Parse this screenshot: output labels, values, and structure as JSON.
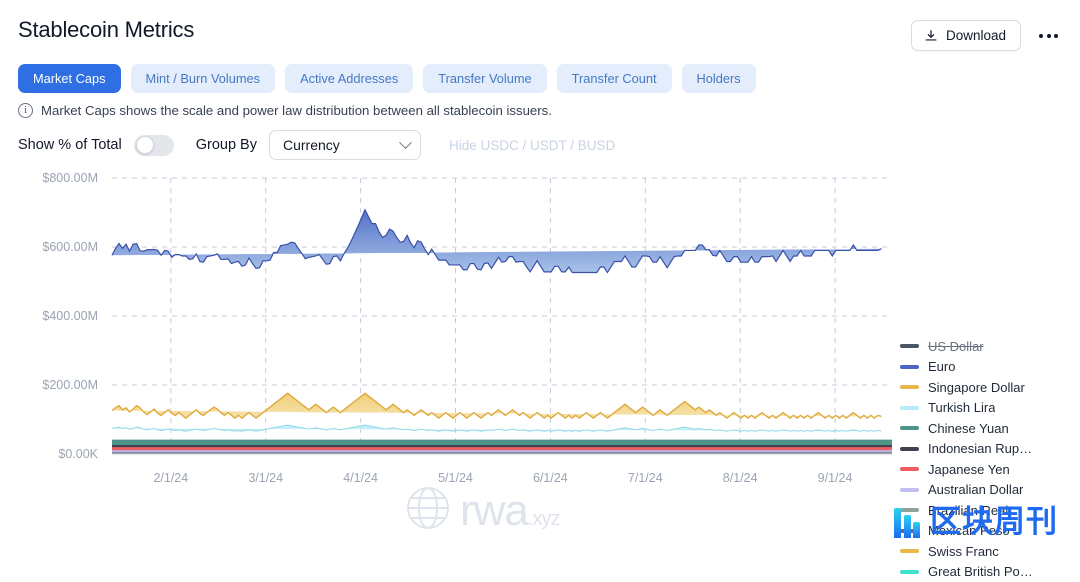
{
  "header": {
    "title": "Stablecoin Metrics",
    "download_label": "Download",
    "download_icon": "download-icon",
    "more_icon": "ellipsis-icon"
  },
  "tabs": [
    {
      "label": "Market Caps",
      "active": true
    },
    {
      "label": "Mint / Burn Volumes",
      "active": false
    },
    {
      "label": "Active Addresses",
      "active": false
    },
    {
      "label": "Transfer Volume",
      "active": false
    },
    {
      "label": "Transfer Count",
      "active": false
    },
    {
      "label": "Holders",
      "active": false
    }
  ],
  "info": {
    "icon": "info-circle-icon",
    "text": "Market Caps shows the scale and power law distribution between all stablecoin issuers."
  },
  "controls": {
    "percent_label": "Show % of Total",
    "percent_toggle_on": false,
    "group_by_label": "Group By",
    "group_by_value": "Currency",
    "group_by_options": [
      "Currency"
    ],
    "hide_stables_label": "Hide USDC / USDT / BUSD",
    "hide_stables_disabled": true
  },
  "watermark": {
    "text": "rwa",
    "suffix": ".xyz",
    "icon": "globe-icon"
  },
  "brand": {
    "text": "区块周刊",
    "icon": "bars-logo-icon"
  },
  "chart_data": {
    "type": "area",
    "stacked": true,
    "title": "",
    "xlabel": "",
    "ylabel": "",
    "grid": true,
    "legend_position": "right",
    "ylim": [
      0,
      800000000
    ],
    "ytick_labels": [
      "$800.00M",
      "$600.00M",
      "$400.00M",
      "$200.00M",
      "$0.00K"
    ],
    "ytick_values": [
      800000000,
      600000000,
      400000000,
      200000000,
      0
    ],
    "xtick_labels": [
      "2/1/24",
      "3/1/24",
      "4/1/24",
      "5/1/24",
      "6/1/24",
      "7/1/24",
      "8/1/24",
      "9/1/24"
    ],
    "colors": {
      "US Dollar": "#4b5563",
      "Euro": "#4e63c8",
      "Singapore Dollar": "#e8b84b",
      "Turkish Lira": "#b6ecf5",
      "Chinese Yuan": "#4e9488",
      "Indonesian Rupiah": "#3f4450",
      "Japanese Yen": "#ef5d62",
      "Australian Dollar": "#c0bdf0",
      "Brazilian Real": "#8fa39a",
      "Mexican Peso": "#5a5fb8",
      "Swiss Franc": "#e8b84b",
      "Great British Pound": "#3fe0cc"
    },
    "legend": [
      {
        "label": "US Dollar",
        "color": "#4b5563",
        "hidden": true
      },
      {
        "label": "Euro",
        "color": "#4e63c8",
        "hidden": false
      },
      {
        "label": "Singapore Dollar",
        "color": "#e8b84b",
        "hidden": false
      },
      {
        "label": "Turkish Lira",
        "color": "#b6ecf5",
        "hidden": false
      },
      {
        "label": "Chinese Yuan",
        "color": "#4e9488",
        "hidden": false
      },
      {
        "label": "Indonesian Rup…",
        "color": "#3f4450",
        "hidden": false
      },
      {
        "label": "Japanese Yen",
        "color": "#ef5d62",
        "hidden": false
      },
      {
        "label": "Australian Dollar",
        "color": "#c0bdf0",
        "hidden": false
      },
      {
        "label": "Brazilian Real",
        "color": "#8fa39a",
        "hidden": false
      },
      {
        "label": "Mexican Peso",
        "color": "#5a5fb8",
        "hidden": false
      },
      {
        "label": "Swiss Franc",
        "color": "#e8b84b",
        "hidden": false
      },
      {
        "label": "Great British Po…",
        "color": "#3fe0cc",
        "hidden": false
      }
    ],
    "series": [
      {
        "name": "Euro",
        "values": [
          450,
          462,
          470,
          468,
          474,
          466,
          478,
          470,
          455,
          466,
          478,
          470,
          463,
          472,
          464,
          470,
          460,
          452,
          466,
          458,
          462,
          470,
          452,
          446,
          452,
          440,
          444,
          452,
          446,
          440,
          450,
          444,
          452,
          446,
          440,
          452,
          446,
          440,
          436,
          448,
          440,
          434,
          428,
          440,
          432,
          426,
          440,
          432,
          444,
          438,
          432,
          446,
          452,
          444,
          438,
          430,
          442,
          436,
          430,
          442,
          436,
          430,
          424,
          436,
          446,
          440,
          452,
          460,
          472,
          486,
          500,
          516,
          532,
          520,
          508,
          516,
          500,
          492,
          506,
          516,
          502,
          492,
          486,
          496,
          506,
          492,
          486,
          498,
          486,
          474,
          466,
          474,
          466,
          458,
          450,
          442,
          436,
          444,
          436,
          428,
          422,
          430,
          440,
          432,
          424,
          430,
          440,
          434,
          426,
          434,
          442,
          436,
          446,
          452,
          444,
          436,
          446,
          438,
          430,
          424,
          432,
          440,
          432,
          424,
          416,
          424,
          432,
          424,
          416,
          424,
          430,
          422,
          414,
          422,
          414,
          406,
          414,
          422,
          414,
          422,
          430,
          422,
          430,
          438,
          430,
          422,
          430,
          422,
          414,
          422,
          430,
          438,
          446,
          452,
          444,
          436,
          444,
          436,
          428,
          436,
          444,
          438,
          430,
          438,
          446,
          454,
          462,
          470,
          478,
          472,
          464,
          456,
          462,
          470,
          462,
          454,
          446,
          452,
          460,
          452,
          444,
          452,
          460,
          452,
          444,
          452,
          460,
          468,
          462,
          454,
          462,
          470,
          462,
          454,
          462,
          470,
          478,
          470,
          462,
          470,
          478,
          470,
          478,
          486,
          478,
          470,
          478,
          486,
          478,
          486,
          478,
          486,
          478,
          486,
          478,
          486,
          478,
          486,
          478,
          486,
          478,
          486,
          490
        ]
      },
      {
        "name": "Singapore Dollar",
        "values": [
          52,
          58,
          62,
          54,
          58,
          50,
          56,
          62,
          58,
          50,
          44,
          50,
          56,
          48,
          44,
          50,
          56,
          48,
          44,
          50,
          44,
          38,
          44,
          50,
          56,
          48,
          44,
          50,
          56,
          62,
          58,
          50,
          44,
          50,
          44,
          38,
          44,
          38,
          44,
          50,
          44,
          38,
          44,
          50,
          56,
          62,
          68,
          74,
          80,
          86,
          92,
          86,
          80,
          74,
          68,
          62,
          56,
          62,
          68,
          62,
          56,
          50,
          56,
          62,
          56,
          50,
          56,
          62,
          68,
          74,
          80,
          86,
          92,
          86,
          80,
          74,
          68,
          62,
          56,
          62,
          68,
          62,
          56,
          50,
          56,
          50,
          44,
          50,
          56,
          50,
          44,
          50,
          44,
          38,
          44,
          50,
          44,
          38,
          44,
          50,
          44,
          38,
          44,
          50,
          44,
          38,
          44,
          50,
          44,
          50,
          56,
          50,
          44,
          50,
          56,
          50,
          44,
          50,
          44,
          38,
          44,
          50,
          44,
          38,
          44,
          38,
          44,
          50,
          44,
          38,
          44,
          38,
          44,
          38,
          44,
          50,
          44,
          38,
          44,
          50,
          44,
          38,
          44,
          50,
          56,
          62,
          68,
          62,
          56,
          50,
          56,
          62,
          56,
          50,
          44,
          50,
          56,
          50,
          44,
          50,
          56,
          62,
          68,
          74,
          68,
          62,
          56,
          62,
          56,
          50,
          56,
          50,
          44,
          50,
          44,
          38,
          44,
          50,
          44,
          38,
          44,
          38,
          44,
          38,
          44,
          50,
          44,
          38,
          44,
          38,
          44,
          50,
          44,
          38,
          44,
          38,
          44,
          38,
          44,
          38,
          44,
          50,
          44,
          38,
          44,
          38,
          44,
          38,
          44,
          38,
          44,
          50,
          44,
          38,
          44,
          38,
          44,
          38,
          44,
          42
        ]
      },
      {
        "name": "Turkish Lira",
        "values": [
          34,
          36,
          38,
          34,
          36,
          32,
          34,
          38,
          36,
          32,
          30,
          32,
          34,
          30,
          28,
          30,
          32,
          30,
          28,
          30,
          28,
          26,
          28,
          30,
          32,
          30,
          28,
          30,
          32,
          34,
          32,
          30,
          28,
          30,
          28,
          26,
          28,
          26,
          28,
          30,
          28,
          26,
          28,
          30,
          32,
          34,
          36,
          38,
          40,
          42,
          44,
          42,
          40,
          38,
          36,
          34,
          32,
          34,
          36,
          34,
          32,
          30,
          32,
          34,
          32,
          30,
          32,
          34,
          36,
          38,
          40,
          42,
          44,
          42,
          40,
          38,
          36,
          34,
          32,
          34,
          36,
          34,
          32,
          30,
          32,
          30,
          28,
          30,
          32,
          30,
          28,
          30,
          28,
          26,
          28,
          30,
          28,
          26,
          28,
          30,
          28,
          26,
          28,
          30,
          28,
          26,
          28,
          30,
          28,
          30,
          32,
          30,
          28,
          30,
          32,
          30,
          28,
          30,
          28,
          26,
          28,
          30,
          28,
          26,
          28,
          26,
          28,
          30,
          28,
          26,
          28,
          26,
          28,
          26,
          28,
          30,
          28,
          26,
          28,
          30,
          28,
          26,
          28,
          30,
          32,
          34,
          36,
          34,
          32,
          30,
          32,
          34,
          32,
          30,
          28,
          30,
          32,
          30,
          28,
          30,
          32,
          34,
          36,
          38,
          36,
          34,
          32,
          34,
          32,
          30,
          32,
          30,
          28,
          30,
          28,
          26,
          28,
          30,
          28,
          26,
          28,
          26,
          28,
          26,
          28,
          30,
          28,
          26,
          28,
          26,
          28,
          30,
          28,
          26,
          28,
          26,
          28,
          26,
          28,
          26,
          28,
          30,
          28,
          26,
          28,
          26,
          28,
          26,
          28,
          26,
          28,
          30,
          28,
          26,
          28,
          26,
          28,
          26,
          28,
          27
        ]
      },
      {
        "name": "Chinese Yuan",
        "values_constant": 14
      },
      {
        "name": "Indonesian Rupiah",
        "values_constant": 6
      },
      {
        "name": "Japanese Yen",
        "values_constant": 9
      },
      {
        "name": "Australian Dollar",
        "values_constant": 5
      },
      {
        "name": "Brazilian Real",
        "values_constant": 2
      },
      {
        "name": "Mexican Peso",
        "values_constant": 2
      },
      {
        "name": "Swiss Franc",
        "values_constant": 1
      },
      {
        "name": "Great British Pound",
        "values_constant": 1
      }
    ]
  }
}
